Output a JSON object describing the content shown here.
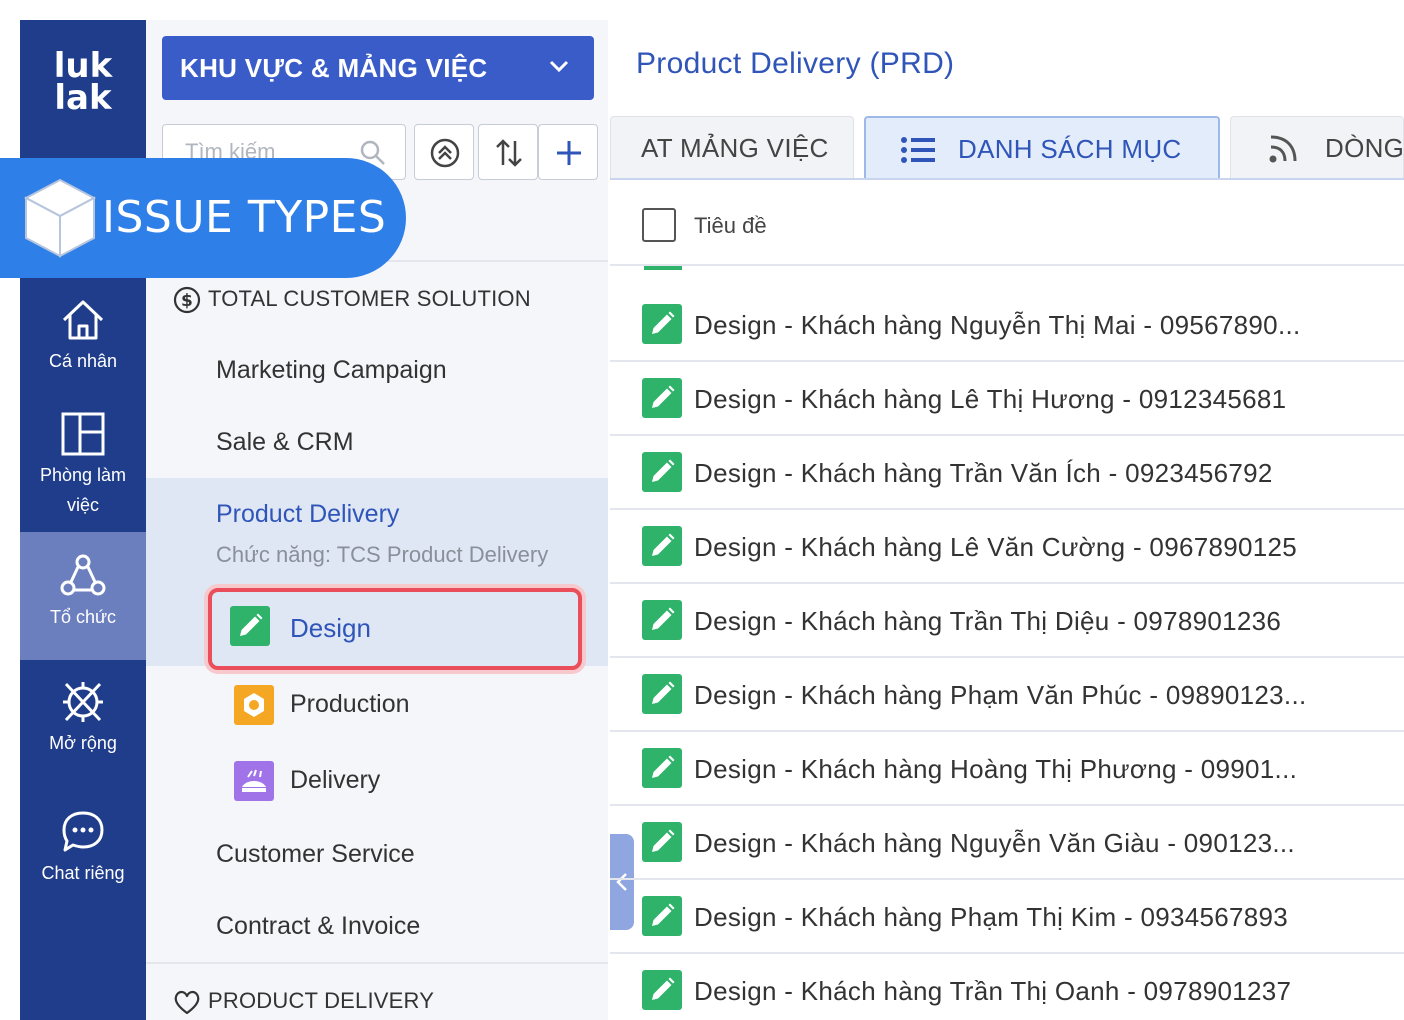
{
  "rail": {
    "logo_line1": "luk",
    "logo_line2": "lak",
    "items": [
      {
        "label": "Cá nhân",
        "icon": "home-icon"
      },
      {
        "label": "Phòng làm việc",
        "icon": "workspace-icon"
      },
      {
        "label": "Tổ chức",
        "icon": "organization-icon",
        "active": true
      },
      {
        "label": "Mở rộng",
        "icon": "extension-icon"
      },
      {
        "label": "Chat riêng",
        "icon": "chat-icon"
      }
    ]
  },
  "banner": {
    "text": "ISSUE TYPES",
    "icon": "cube-icon"
  },
  "sidebar": {
    "area_select": "KHU VỰC & MẢNG VIỆC",
    "search_placeholder": "Tìm kiếm",
    "group1": "TOTAL CUSTOMER SOLUTION",
    "items": [
      "Marketing Campaign",
      "Sale & CRM"
    ],
    "product_delivery": {
      "title": "Product Delivery",
      "subtitle": "Chức năng: TCS Product Delivery",
      "children": [
        "Design",
        "Production",
        "Delivery"
      ]
    },
    "items_after": [
      "Customer Service",
      "Contract & Invoice"
    ],
    "group2": "PRODUCT DELIVERY"
  },
  "main": {
    "title": "Product Delivery (PRD)",
    "tabs": [
      "AT MẢNG VIỆC",
      "DANH SÁCH MỤC",
      "DÒNG"
    ],
    "column_header": "Tiêu đề",
    "rows": [
      "Design - Khách hàng Nguyễn Thị Mai - 09567890...",
      "Design - Khách hàng Lê Thị Hương - 0912345681",
      "Design - Khách hàng Trần Văn Ích - 0923456792",
      "Design - Khách hàng Lê Văn Cường - 0967890125",
      "Design - Khách hàng Trần Thị Diệu - 0978901236",
      "Design - Khách hàng Phạm Văn Phúc - 09890123...",
      "Design - Khách hàng Hoàng Thị Phương - 09901...",
      "Design - Khách hàng Nguyễn Văn Giàu - 090123...",
      "Design - Khách hàng Phạm Thị Kim - 0934567893",
      "Design - Khách hàng Trần Thị Oanh - 0978901237"
    ]
  },
  "colors": {
    "rail": "#1f3d8a",
    "accent": "#2f55b9",
    "design_green": "#2fb36a",
    "highlight_red": "#ea4e5a",
    "banner_blue": "#2f7fe8"
  }
}
